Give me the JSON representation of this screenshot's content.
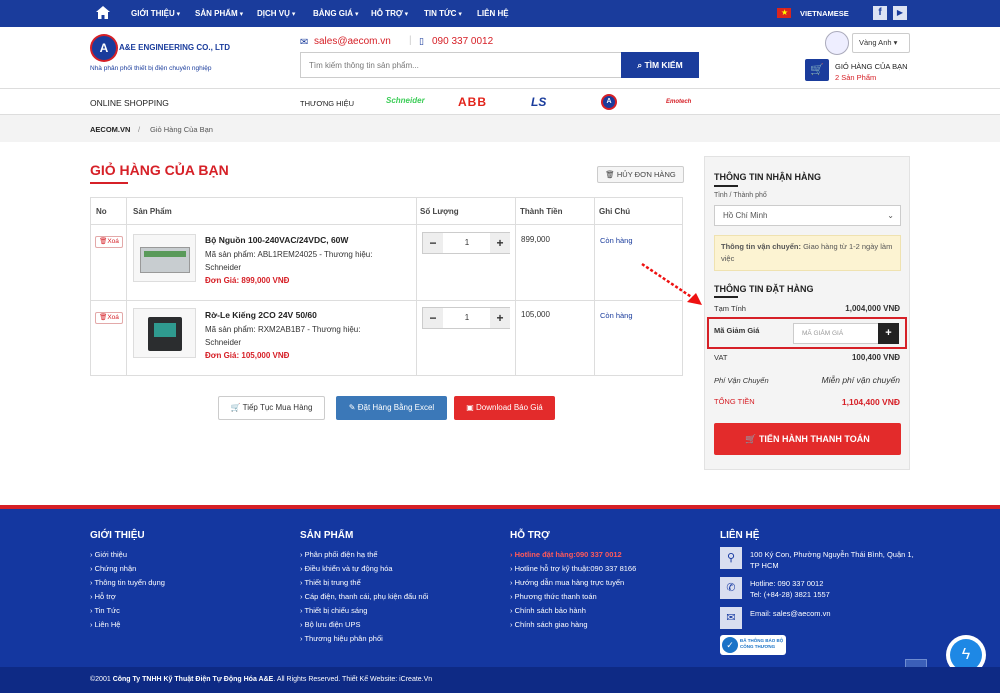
{
  "topnav": {
    "items": [
      "GIỚI THIỆU",
      "SẢN PHẨM",
      "DỊCH VỤ",
      "BẢNG GIÁ",
      "HỖ TRỢ",
      "TIN TỨC",
      "LIÊN HỆ"
    ],
    "language": "VIETNAMESE"
  },
  "header": {
    "logo_text": "A&E ENGINEERING CO., LTD",
    "tagline": "Nhà phân phối thiết bị điện chuyên nghiệp",
    "email": "sales@aecom.vn",
    "phone": "090 337 0012",
    "search_placeholder": "Tìm kiếm thông tin sản phẩm...",
    "search_button": "TÌM KIẾM",
    "lang_select": "Vàng Anh",
    "cart_title": "GIỎ HÀNG CỦA BẠN",
    "cart_count": "2 Sản Phẩm"
  },
  "shopbar": {
    "online": "ONLINE SHOPPING",
    "brands_label": "THƯƠNG HIỆU",
    "brands": [
      "Schneider",
      "ABB",
      "LS",
      "A&E",
      "Emotech"
    ]
  },
  "breadcrumb": {
    "home": "AECOM.VN",
    "current": "Giỏ Hàng Của Bạn"
  },
  "cart": {
    "title": "GIỎ HÀNG CỦA BẠN",
    "clear_button": "HỦY ĐƠN HÀNG",
    "headers": [
      "No",
      "Sản Phẩm",
      "Số Lượng",
      "Thành Tiền",
      "Ghi Chú"
    ],
    "remove_label": "Xoá",
    "items": [
      {
        "name": "Bộ Nguồn 100-240VAC/24VDC, 60W",
        "code_label": "Mã sản phẩm:",
        "code": "ABL1REM24025",
        "brand_label": "Thương hiệu:",
        "brand": "Schneider",
        "price_label": "Đơn Giá:",
        "price": "899,000 VNĐ",
        "qty": "1",
        "total": "899,000",
        "note": "Còn hàng"
      },
      {
        "name": "Rờ-Le Kiếng 2CO 24V 50/60",
        "code_label": "Mã sản phẩm:",
        "code": "RXM2AB1B7",
        "brand_label": "Thương hiệu:",
        "brand": "Schneider",
        "price_label": "Đơn Giá:",
        "price": "105,000 VNĐ",
        "qty": "1",
        "total": "105,000",
        "note": "Còn hàng"
      }
    ],
    "continue_button": "Tiếp Tục Mua Hàng",
    "excel_button": "Đặt Hàng Bằng Excel",
    "pdf_button": "Download Báo Giá"
  },
  "sidebar": {
    "receive_title": "THÔNG TIN NHẬN HÀNG",
    "city_label": "Tỉnh / Thành phố",
    "city_value": "Hồ Chí Minh",
    "shipping_notice_bold": "Thông tin vận chuyển:",
    "shipping_notice": " Giao hàng từ 1-2 ngày làm việc",
    "order_title": "THÔNG TIN ĐẶT HÀNG",
    "subtotal_label": "Tạm Tính",
    "subtotal": "1,004,000 VNĐ",
    "coupon_label": "Mã Giảm Giá",
    "coupon_placeholder": "MÃ GIẢM GIÁ",
    "vat_label": "VAT",
    "vat": "100,400 VNĐ",
    "ship_label": "Phí Vận Chuyển",
    "ship": "Miễn phí vận chuyển",
    "total_label": "TỔNG TIỀN",
    "total": "1,104,400 VNĐ",
    "checkout_button": "TIẾN HÀNH THANH TOÁN"
  },
  "footer": {
    "about_title": "GIỚI THIỆU",
    "about_links": [
      "Giới thiệu",
      "Chứng nhận",
      "Thông tin tuyển dụng",
      "Hỗ trợ",
      "Tin Tức",
      "Liên Hệ"
    ],
    "products_title": "SẢN PHẨM",
    "products_links": [
      "Phân phối điện hạ thế",
      "Điều khiển và tự động hóa",
      "Thiết bị trung thế",
      "Cáp điện, thanh cái, phụ kiện đấu nối",
      "Thiết bị chiếu sáng",
      "Bộ lưu điện UPS",
      "Thương hiệu phân phối"
    ],
    "support_title": "HỖ TRỢ",
    "support_hotline": "Hotline đặt hàng:090 337 0012",
    "support_links": [
      "Hotline hỗ trợ kỹ thuật:090 337 8166",
      "Hướng dẫn mua hàng trực tuyến",
      "Phương thức thanh toán",
      "Chính sách bảo hành",
      "Chính sách giao hàng"
    ],
    "contact_title": "LIÊN HỆ",
    "address": "100 Ký Con, Phường Nguyễn Thái Bình, Quận 1, TP HCM",
    "hotline": "Hotline: 090 337 0012",
    "tel": "Tel: (+84-28) 3821 1557",
    "email": "Email: sales@aecom.vn",
    "badge": "ĐÃ THÔNG BÁO BỘ CÔNG THƯƠNG",
    "copyright_pre": "©2001 ",
    "copyright_company": "Công Ty TNHH Kỹ Thuật Điện Tự Động Hóa A&E",
    "copyright_post": ". All Rights Reserved. Thiết Kế Website: iCreate.Vn"
  },
  "colors": {
    "nav": "#1a3c9c",
    "accent_red": "#d62027",
    "footer": "#1437a0"
  }
}
